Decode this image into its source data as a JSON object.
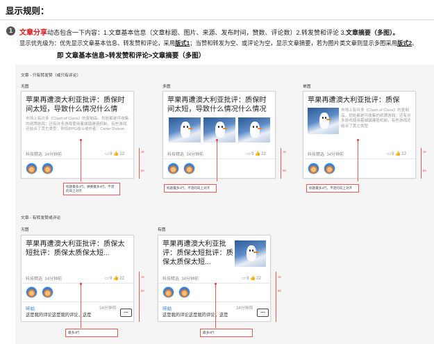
{
  "heading": "显示规则：",
  "rule": {
    "number": "1",
    "title": "文章分享",
    "desc_main": "动态包含一下内容：1.文章基本信息（文章标题、图片、来源、发布时间，赞数、评论数）2.转发赞和评论 3.",
    "desc_tail": "文章摘要（多图）。",
    "priority_a": "显示优先级为：优先显示文章基本信息、转发赞和评论，采用",
    "style1": "版式1",
    "priority_b": "；当赞和转发为空、或评论为空，显示文章摘要，若为图片类文章则显示多图采用",
    "style2": "版式2",
    "priority_c": "。",
    "order": "即  文章基本信息>转发赞和评论>文章摘要（多图）"
  },
  "section1": "文章 - 只有转发赞（或只有评论）",
  "section2": "文章 - 有转发赞或评论",
  "labels": {
    "no_image": "无图",
    "multi_image": "多图",
    "single_image": "单图",
    "no_image2": "无图",
    "has_image": "有图"
  },
  "cards": {
    "c1_title": "苹果再遭澳大利亚批评：质保时间太短，导致什么情况什么情",
    "c1_summary": "市场上有许多《Clash of Clans》的复制品，划处都是可收集的纸牌游戏；还有许多游戏使用着城镇建造机制，有些游戏还结合了其它类型，例如RPG战斗或作者：Carter Dotson",
    "c2_title": "苹果再遭澳大利亚批评：质保时间太短，导致什么情况什么情况",
    "c3_title": "苹果再遭澳大利亚批评：质保",
    "c3_summary": "市场上有许多《Clash of Clans》的复制品，划处都是可收集的纸牌游戏；还有许多游戏使用着城镇建造机制，有些游戏还结合了其它类型",
    "c4_title": "苹果再遭澳大利亚批评：质保太短批评：质保太质保太短...",
    "c5_title": "苹果再遭澳大利亚批评：质保太短批评：质保太质保太短...",
    "source": "科技精选",
    "time": "34分钟前",
    "comment_count": "9",
    "like_count": "22",
    "commenter": "碎蛄",
    "comment_time": "34分钟前",
    "comment_text": "这是我的评论这是我的评论，这是",
    "more": "..."
  },
  "notes": {
    "n1": "标题最多2行，摘要最多3行，不足的向上对齐",
    "n2": "标题最多2行，不足的向上对齐",
    "n3": "标题最多2行，不足的向上对齐",
    "n4": "最多3行",
    "n5": "最多3行"
  },
  "gap_values": {
    "g16": "16",
    "g18": "18",
    "g58": "58"
  }
}
